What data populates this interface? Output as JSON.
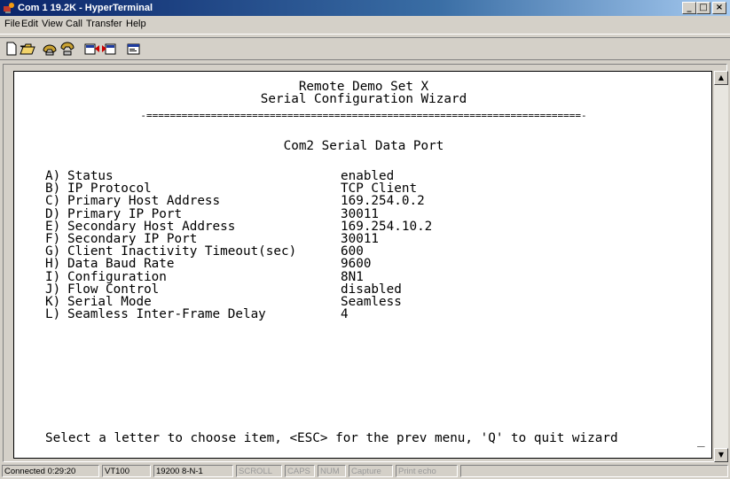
{
  "window": {
    "title": "Com 1 19.2K - HyperTerminal"
  },
  "menu": [
    "File",
    "Edit",
    "View",
    "Call",
    "Transfer",
    "Help"
  ],
  "toolbar": {
    "icons": [
      "new-icon",
      "open-icon",
      "connect-icon",
      "disconnect-icon",
      "send-icon",
      "receive-icon",
      "properties-icon"
    ]
  },
  "terminal": {
    "header1": "Remote Demo Set X",
    "header2": "Serial Configuration Wizard",
    "separator": "-==========================================================================-",
    "section_title": "Com2 Serial Data Port",
    "items": [
      {
        "key": "A)",
        "label": "Status",
        "value": "enabled"
      },
      {
        "key": "B)",
        "label": "IP Protocol",
        "value": "TCP Client"
      },
      {
        "key": "C)",
        "label": "Primary Host Address",
        "value": "169.254.0.2"
      },
      {
        "key": "D)",
        "label": "Primary IP Port",
        "value": "30011"
      },
      {
        "key": "E)",
        "label": "Secondary Host Address",
        "value": "169.254.10.2"
      },
      {
        "key": "F)",
        "label": "Secondary IP Port",
        "value": "30011"
      },
      {
        "key": "G)",
        "label": "Client Inactivity Timeout(sec)",
        "value": "600"
      },
      {
        "key": "H)",
        "label": "Data Baud Rate",
        "value": "9600"
      },
      {
        "key": "I)",
        "label": "Configuration",
        "value": "8N1"
      },
      {
        "key": "J)",
        "label": "Flow Control",
        "value": "disabled"
      },
      {
        "key": "K)",
        "label": "Serial Mode",
        "value": "Seamless"
      },
      {
        "key": "L)",
        "label": "Seamless Inter-Frame Delay",
        "value": "4"
      }
    ],
    "prompt": "Select a letter to choose item, <ESC> for the prev menu, 'Q' to quit wizard",
    "cursor": "_"
  },
  "status": {
    "connected": "Connected 0:29:20",
    "emulation": "VT100",
    "port_settings": "19200 8-N-1",
    "scroll": "SCROLL",
    "caps": "CAPS",
    "num": "NUM",
    "capture": "Capture",
    "print_echo": "Print echo"
  }
}
